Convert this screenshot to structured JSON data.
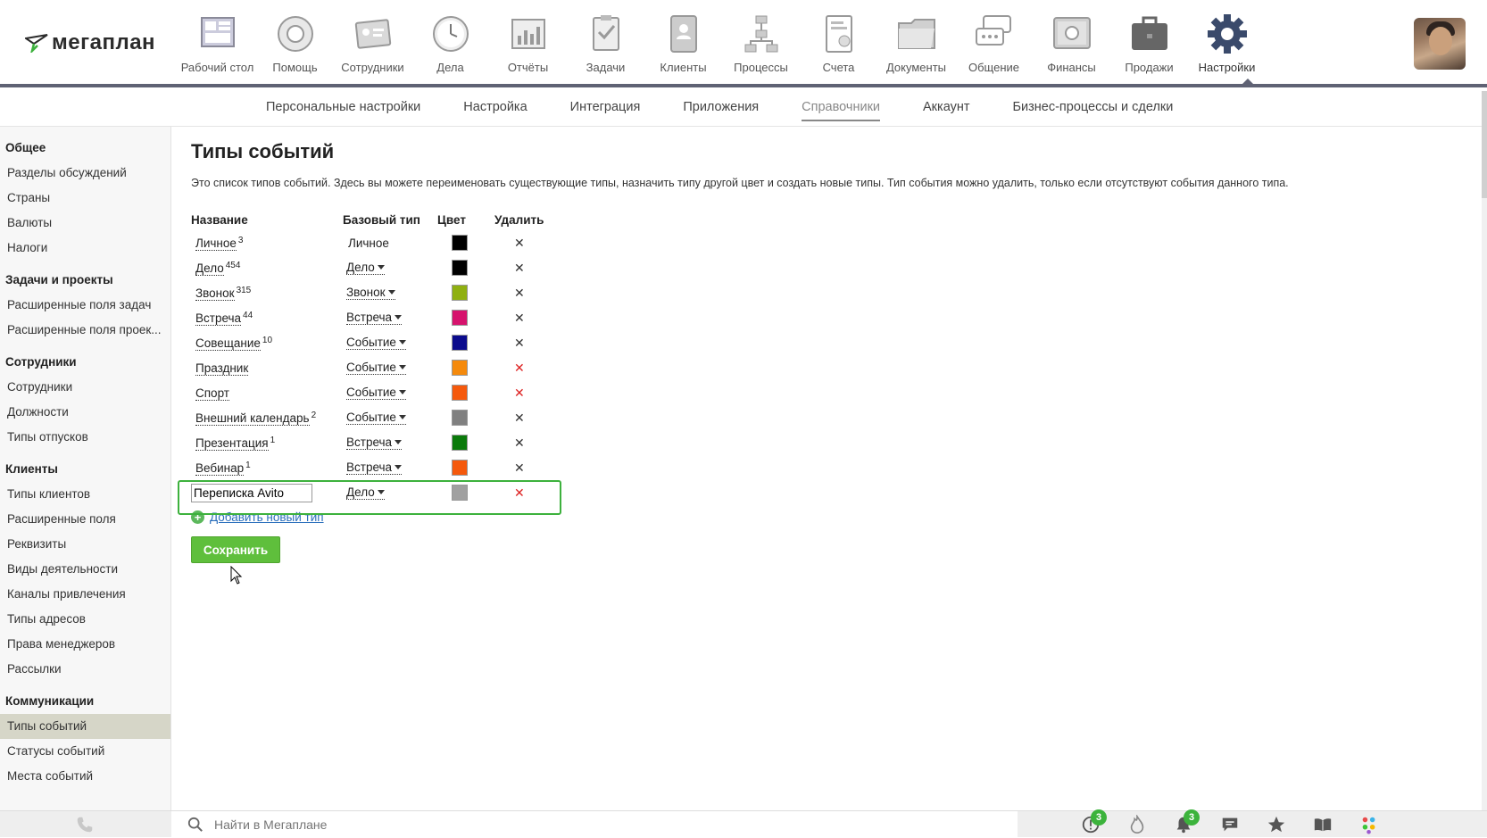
{
  "logo": {
    "text": "мегаплан"
  },
  "nav": [
    {
      "label": "Рабочий стол",
      "icon": "desktop-icon"
    },
    {
      "label": "Помощь",
      "icon": "lifebuoy-icon"
    },
    {
      "label": "Сотрудники",
      "icon": "employees-icon"
    },
    {
      "label": "Дела",
      "icon": "clock-icon"
    },
    {
      "label": "Отчёты",
      "icon": "chart-icon"
    },
    {
      "label": "Задачи",
      "icon": "clipboard-icon"
    },
    {
      "label": "Клиенты",
      "icon": "address-book-icon"
    },
    {
      "label": "Процессы",
      "icon": "flowchart-icon"
    },
    {
      "label": "Счета",
      "icon": "invoice-icon"
    },
    {
      "label": "Документы",
      "icon": "folder-icon"
    },
    {
      "label": "Общение",
      "icon": "chat-icon"
    },
    {
      "label": "Финансы",
      "icon": "safe-icon"
    },
    {
      "label": "Продажи",
      "icon": "briefcase-icon"
    },
    {
      "label": "Настройки",
      "icon": "gear-icon",
      "active": true
    }
  ],
  "subnav": [
    {
      "label": "Персональные настройки"
    },
    {
      "label": "Настройка"
    },
    {
      "label": "Интеграция"
    },
    {
      "label": "Приложения"
    },
    {
      "label": "Справочники",
      "active": true
    },
    {
      "label": "Аккаунт"
    },
    {
      "label": "Бизнес-процессы и сделки"
    }
  ],
  "sidebar": {
    "groups": [
      {
        "title": "Общее",
        "items": [
          "Разделы обсуждений",
          "Страны",
          "Валюты",
          "Налоги"
        ]
      },
      {
        "title": "Задачи и проекты",
        "items": [
          "Расширенные поля задач",
          "Расширенные поля проек..."
        ]
      },
      {
        "title": "Сотрудники",
        "items": [
          "Сотрудники",
          "Должности",
          "Типы отпусков"
        ]
      },
      {
        "title": "Клиенты",
        "items": [
          "Типы клиентов",
          "Расширенные поля",
          "Реквизиты",
          "Виды деятельности",
          "Каналы привлечения",
          "Типы адресов",
          "Права менеджеров",
          "Рассылки"
        ]
      },
      {
        "title": "Коммуникации",
        "items": [
          "Типы событий",
          "Статусы событий",
          "Места событий"
        ]
      }
    ],
    "active_item": "Типы событий"
  },
  "main": {
    "title": "Типы событий",
    "description": "Это список типов событий. Здесь вы можете переименовать существующие типы, назначить типу другой цвет и создать новые типы. Тип события можно удалить, только если отсутствуют события данного типа.",
    "columns": {
      "name": "Название",
      "base": "Базовый тип",
      "color": "Цвет",
      "delete": "Удалить"
    },
    "rows": [
      {
        "name": "Личное",
        "count": "3",
        "base": "Личное",
        "base_editable": false,
        "color": "#000000",
        "deletable": false
      },
      {
        "name": "Дело",
        "count": "454",
        "base": "Дело",
        "base_editable": true,
        "color": "#000000",
        "deletable": false
      },
      {
        "name": "Звонок",
        "count": "315",
        "base": "Звонок",
        "base_editable": true,
        "color": "#8fb011",
        "deletable": false
      },
      {
        "name": "Встреча",
        "count": "44",
        "base": "Встреча",
        "base_editable": true,
        "color": "#d6136d",
        "deletable": false
      },
      {
        "name": "Совещание",
        "count": "10",
        "base": "Событие",
        "base_editable": true,
        "color": "#0a0a8c",
        "deletable": false
      },
      {
        "name": "Праздник",
        "count": "",
        "base": "Событие",
        "base_editable": true,
        "color": "#f58a0c",
        "deletable": true
      },
      {
        "name": "Спорт",
        "count": "",
        "base": "Событие",
        "base_editable": true,
        "color": "#f5590c",
        "deletable": true
      },
      {
        "name": "Внешний календарь",
        "count": "2",
        "base": "Событие",
        "base_editable": true,
        "color": "#808080",
        "deletable": false
      },
      {
        "name": "Презентация",
        "count": "1",
        "base": "Встреча",
        "base_editable": true,
        "color": "#0a7a0a",
        "deletable": false
      },
      {
        "name": "Вебинар",
        "count": "1",
        "base": "Встреча",
        "base_editable": true,
        "color": "#f5590c",
        "deletable": false
      }
    ],
    "new_row": {
      "name_value": "Переписка Avito",
      "base": "Дело",
      "color": "#a0a0a0"
    },
    "add_link": "Добавить новый тип",
    "save_label": "Сохранить"
  },
  "bottombar": {
    "search_placeholder": "Найти в Мегаплане",
    "icons": [
      {
        "name": "alert-icon",
        "badge": "3"
      },
      {
        "name": "flame-icon",
        "badge": ""
      },
      {
        "name": "bell-icon",
        "badge": "3"
      },
      {
        "name": "message-icon",
        "badge": ""
      },
      {
        "name": "star-icon",
        "badge": ""
      },
      {
        "name": "book-icon",
        "badge": ""
      },
      {
        "name": "apps-icon",
        "badge": ""
      }
    ]
  },
  "colors": {
    "accent_green": "#5fbf3c",
    "nav_bar": "#5f6274",
    "link_blue": "#2a6ebb"
  }
}
